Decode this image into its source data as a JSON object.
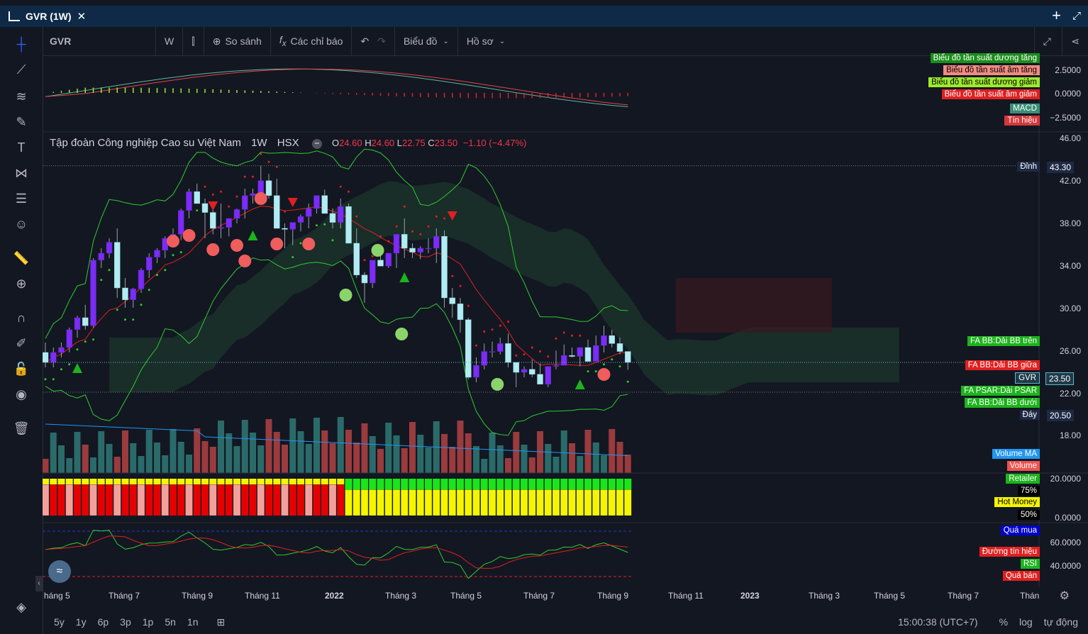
{
  "window": {
    "title": "GVR (1W)"
  },
  "toolbar": {
    "symbol": "GVR",
    "interval": "W",
    "compare": "So sánh",
    "indicators": "Các chỉ báo",
    "chart_type": "Biểu đồ",
    "profile": "Hồ sơ"
  },
  "legend": {
    "name": "Tập đoàn Công nghiệp Cao su Việt Nam",
    "interval": "1W",
    "exchange": "HSX",
    "o_label": "O",
    "o": "24.60",
    "h_label": "H",
    "h": "24.60",
    "l_label": "L",
    "l": "22.75",
    "c_label": "C",
    "c": "23.50",
    "change": "−1.10 (−4.47%)"
  },
  "macd_pane": {
    "labels": [
      "Biểu đồ tần suất dương tăng",
      "Biểu đồ tần suất âm tăng",
      "Biểu đồ tần suất dương giảm",
      "Biểu đồ tần suất âm giảm",
      "MACD",
      "Tín hiệu"
    ],
    "axis": [
      "2.5000",
      "0.0000",
      "−2.5000"
    ]
  },
  "price_pane": {
    "axis": [
      "46.00",
      "42.00",
      "38.00",
      "34.00",
      "30.00",
      "26.00",
      "22.00",
      "18.00"
    ],
    "top_label": "Đỉnh",
    "top_value": "43.30",
    "bottom_label": "Đáy",
    "bottom_value": "20.50",
    "symbol_label": "GVR",
    "last_price": "23.50",
    "bb_upper": "FA BB:Dải BB trên",
    "bb_mid": "FA BB:Dải BB giữa",
    "psar": "FA PSAR:Dải PSAR",
    "bb_lower": "FA BB:Dải BB dưới",
    "volume_ma": "Volume MA",
    "volume": "Volume"
  },
  "flow_pane": {
    "retailer": "Retailer",
    "retailer_pct": "75%",
    "hot_money": "Hot Money",
    "hot_pct": "50%",
    "axis": [
      "20.0000",
      "0.0000"
    ]
  },
  "rsi_pane": {
    "overbought": "Quá mua",
    "signal": "Đường tín hiệu",
    "rsi": "RSI",
    "oversold": "Quá bán",
    "axis": [
      "60.0000",
      "40.0000"
    ]
  },
  "xaxis": [
    "háng 5",
    "Tháng 7",
    "Tháng 9",
    "Tháng 11",
    "2022",
    "Tháng 3",
    "Tháng 5",
    "Tháng 7",
    "Tháng 9",
    "Tháng 11",
    "2023",
    "Tháng 3",
    "Tháng 5",
    "Tháng 7",
    "Thán"
  ],
  "bottom": {
    "ranges": [
      "5y",
      "1y",
      "6p",
      "3p",
      "1p",
      "5n",
      "1n"
    ],
    "time": "15:00:38 (UTC+7)",
    "pct": "%",
    "log": "log",
    "auto": "tự động"
  },
  "colors": {
    "up": "#7b2cf5",
    "down": "#b2ebf2",
    "bg": "#131722",
    "accent": "#2962ff"
  },
  "chart_data": {
    "type": "candlestick",
    "ylim": [
      16,
      46
    ],
    "candles": [
      [
        24.5,
        25.5,
        23,
        23.5
      ],
      [
        23.5,
        25,
        23,
        24.5
      ],
      [
        24.5,
        25.5,
        24,
        25
      ],
      [
        25,
        27,
        24.5,
        26.8
      ],
      [
        26.8,
        28.2,
        26,
        28
      ],
      [
        28,
        29.3,
        26.8,
        27.2
      ],
      [
        27.2,
        34,
        27,
        33.8
      ],
      [
        33.8,
        35,
        33,
        34.5
      ],
      [
        34.5,
        36,
        34,
        35.6
      ],
      [
        35.6,
        37,
        30,
        31
      ],
      [
        31,
        32,
        29,
        29.8
      ],
      [
        29.8,
        31,
        29,
        30.9
      ],
      [
        30.9,
        33,
        30.5,
        32.8
      ],
      [
        32.8,
        34.5,
        32,
        34.1
      ],
      [
        34.1,
        35,
        33.5,
        34.8
      ],
      [
        34.8,
        36.2,
        34,
        36
      ],
      [
        36,
        37,
        35.5,
        36.4
      ],
      [
        36.4,
        39,
        35.8,
        38.8
      ],
      [
        38.8,
        41,
        38,
        40.7
      ],
      [
        40.7,
        41.5,
        40,
        39.5
      ],
      [
        39.5,
        40,
        36,
        38.6
      ],
      [
        38.6,
        39.2,
        36.4,
        37
      ],
      [
        37,
        39.5,
        36,
        37.1
      ],
      [
        37.1,
        38,
        36.2,
        38
      ],
      [
        38,
        39,
        37.5,
        38.9
      ],
      [
        38.9,
        41,
        38,
        40.3
      ],
      [
        40.3,
        41,
        39.5,
        40.5
      ],
      [
        40.5,
        43.3,
        40,
        41.8
      ],
      [
        41.8,
        42.5,
        40,
        40.3
      ],
      [
        40.3,
        42,
        37,
        37
      ],
      [
        37,
        37.5,
        35,
        36.9
      ],
      [
        36.9,
        37.2,
        35.3,
        37.6
      ],
      [
        37.6,
        38.4,
        36.7,
        38.2
      ],
      [
        38.2,
        39.5,
        37,
        39
      ],
      [
        39,
        40,
        38.5,
        40.3
      ],
      [
        40.3,
        40.9,
        38.6,
        38.5
      ],
      [
        38.5,
        39,
        37,
        37.6
      ],
      [
        37.6,
        40,
        37,
        39.2
      ],
      [
        39.2,
        39.5,
        35.5,
        35.5
      ],
      [
        35.5,
        37,
        32,
        32.3
      ],
      [
        32.3,
        32.6,
        29.5,
        31.5
      ],
      [
        31.5,
        33,
        31,
        33.8
      ],
      [
        33.8,
        35,
        33.5,
        33.2
      ],
      [
        33.2,
        34.5,
        33,
        34.5
      ],
      [
        34.5,
        36,
        33,
        36.4
      ],
      [
        36.4,
        38,
        34,
        35
      ],
      [
        35,
        35.5,
        34,
        34.6
      ],
      [
        34.6,
        35.2,
        33.9,
        35
      ],
      [
        35,
        36,
        34.5,
        35
      ],
      [
        35,
        37,
        33.5,
        36.2
      ],
      [
        36.2,
        36.8,
        29,
        30
      ],
      [
        30,
        31,
        28,
        29.4
      ],
      [
        29.4,
        30,
        26.5,
        27.8
      ],
      [
        27.8,
        28,
        21.8,
        22
      ],
      [
        22,
        24,
        21.5,
        23.2
      ],
      [
        23.2,
        25.4,
        22.8,
        24.6
      ],
      [
        24.6,
        25.6,
        24,
        24.6
      ],
      [
        24.6,
        26,
        24.3,
        25.4
      ],
      [
        25.4,
        26.4,
        23,
        23.5
      ],
      [
        23.5,
        23,
        21,
        22.5
      ],
      [
        22.5,
        23.1,
        22,
        22.8
      ],
      [
        22.8,
        23.8,
        22,
        22.3
      ],
      [
        22.3,
        23.4,
        21.5,
        21.3
      ],
      [
        21.3,
        22.9,
        21,
        23.1
      ],
      [
        23.1,
        24.7,
        22.8,
        23.2
      ],
      [
        23.2,
        25.3,
        23.4,
        24.2
      ],
      [
        24.2,
        25,
        24,
        24.1
      ],
      [
        24.1,
        25,
        23.1,
        25
      ],
      [
        25,
        25.8,
        23.8,
        23.6
      ],
      [
        23.6,
        26.2,
        23.8,
        25.2
      ],
      [
        25.2,
        27.2,
        24.5,
        26.2
      ],
      [
        26.2,
        26.8,
        25,
        25.4
      ],
      [
        25.4,
        26,
        24.3,
        24.6
      ],
      [
        24.6,
        24.6,
        22.75,
        23.5
      ]
    ]
  }
}
